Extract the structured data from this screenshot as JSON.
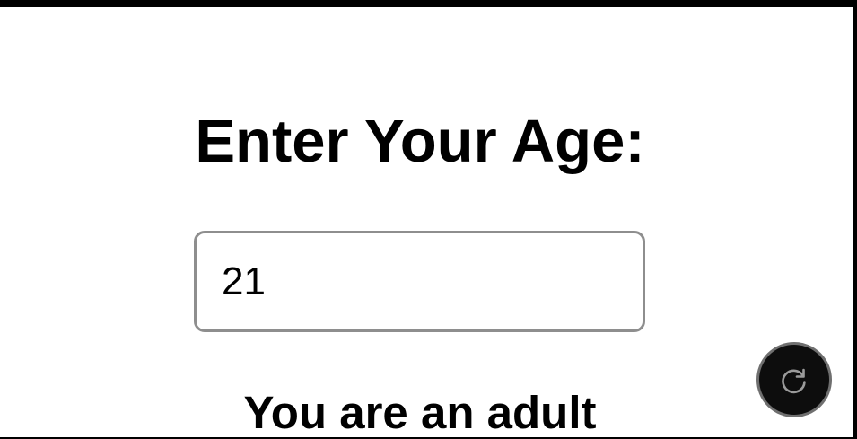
{
  "page": {
    "heading": "Enter Your Age:",
    "age_input": {
      "value": "21",
      "type": "number"
    },
    "result_text": "You are an adult"
  },
  "controls": {
    "reload_icon": "refresh-icon"
  },
  "colors": {
    "background": "#ffffff",
    "frame": "#000000",
    "input_border": "#8e8e8e",
    "reload_button_bg": "#0d0d0d",
    "reload_icon": "#9a9a9a"
  }
}
